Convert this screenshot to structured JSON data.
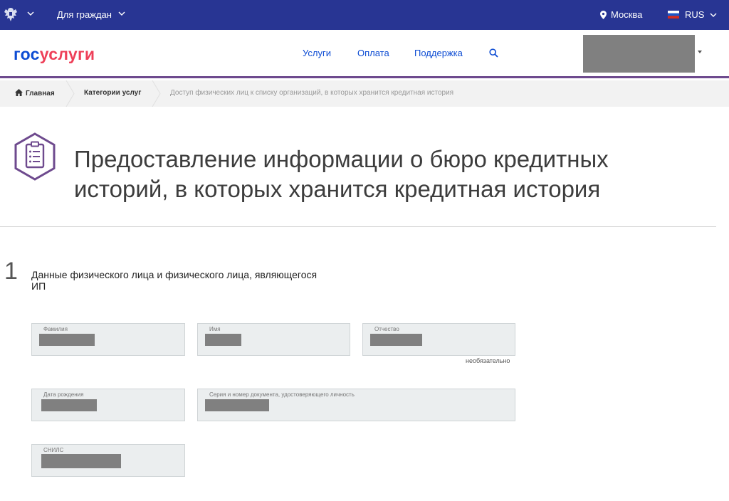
{
  "topbar": {
    "citizens_label": "Для граждан",
    "location": "Москва",
    "language": "RUS",
    "colors": {
      "background": "#283593"
    }
  },
  "header": {
    "logo_part1": "гос",
    "logo_part2": "услуги",
    "nav": [
      "Услуги",
      "Оплата",
      "Поддержка"
    ],
    "icons": [
      "search-icon"
    ]
  },
  "breadcrumb": {
    "home": "Главная",
    "categories": "Категории услуг",
    "current": "Доступ физических лиц к списку организаций, в которых хранится кредитная история"
  },
  "page": {
    "title_line1": "Предоставление информации о бюро кредитных",
    "title_line2": "историй, в которых хранится кредитная история"
  },
  "step": {
    "number": "1",
    "title_line1": "Данные физического лица и физического лица, являющегося",
    "title_line2": "ИП"
  },
  "form": {
    "surname_label": "Фамилия",
    "name_label": "Имя",
    "patronymic_label": "Отчество",
    "optional_hint": "необязательно",
    "birthdate_label": "Дата рождения",
    "document_label": "Серия и номер документа, удостоверяющего личность",
    "snils_label": "СНИЛС"
  },
  "colors": {
    "accent": "#0d4cd3",
    "brand_red": "#ee3f58",
    "purple": "#6e4a8e",
    "field_bg": "#ebeeef"
  }
}
